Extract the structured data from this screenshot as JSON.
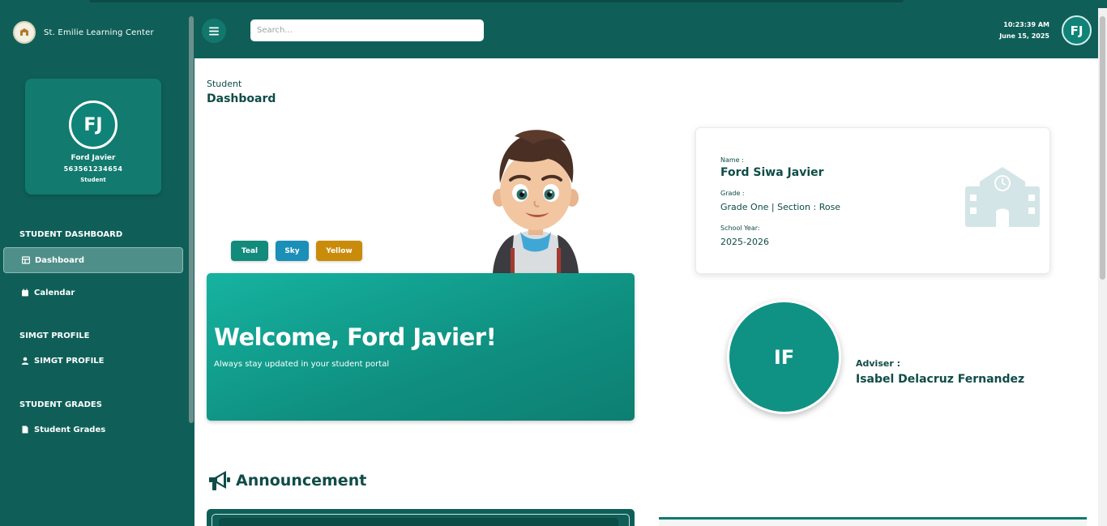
{
  "brand": {
    "name": "St. Emilie Learning Center"
  },
  "profile": {
    "initials": "FJ",
    "name": "Ford Javier",
    "id": "563561234654",
    "role": "Student"
  },
  "sidebar": {
    "sections": [
      {
        "title": "STUDENT DASHBOARD",
        "items": [
          {
            "label": "Dashboard",
            "icon": "dashboard-icon",
            "active": true
          },
          {
            "label": "Calendar",
            "icon": "calendar-icon",
            "active": false
          }
        ]
      },
      {
        "title": "SIMGT PROFILE",
        "items": [
          {
            "label": "SIMGT PROFILE",
            "icon": "user-icon",
            "active": false
          }
        ]
      },
      {
        "title": "STUDENT GRADES",
        "items": [
          {
            "label": "Student Grades",
            "icon": "document-icon",
            "active": false
          }
        ]
      }
    ]
  },
  "header": {
    "search_placeholder": "Search...",
    "time": "10:23:39 AM",
    "date": "June 15, 2025",
    "avatar_initials": "FJ"
  },
  "breadcrumb": {
    "small": "Student",
    "title": "Dashboard"
  },
  "themes": [
    {
      "label": "Teal",
      "color": "#128a7c"
    },
    {
      "label": "Sky",
      "color": "#1a8fb8"
    },
    {
      "label": "Yellow",
      "color": "#c98b0a"
    }
  ],
  "welcome": {
    "title": "Welcome, Ford Javier!",
    "subtitle": "Always stay updated in your student portal"
  },
  "info": {
    "name_label": "Name :",
    "name": "Ford Siwa Javier",
    "grade_label": "Grade :",
    "grade": "Grade One | Section : Rose",
    "year_label": "School Year:",
    "year": "2025-2026"
  },
  "adviser": {
    "initials": "IF",
    "label": "Adviser :",
    "name": "Isabel Delacruz Fernandez"
  },
  "announcement": {
    "title": "Announcement"
  },
  "colors": {
    "primary": "#0f5f58",
    "accent": "#0f9184",
    "text": "#0f4c47"
  }
}
